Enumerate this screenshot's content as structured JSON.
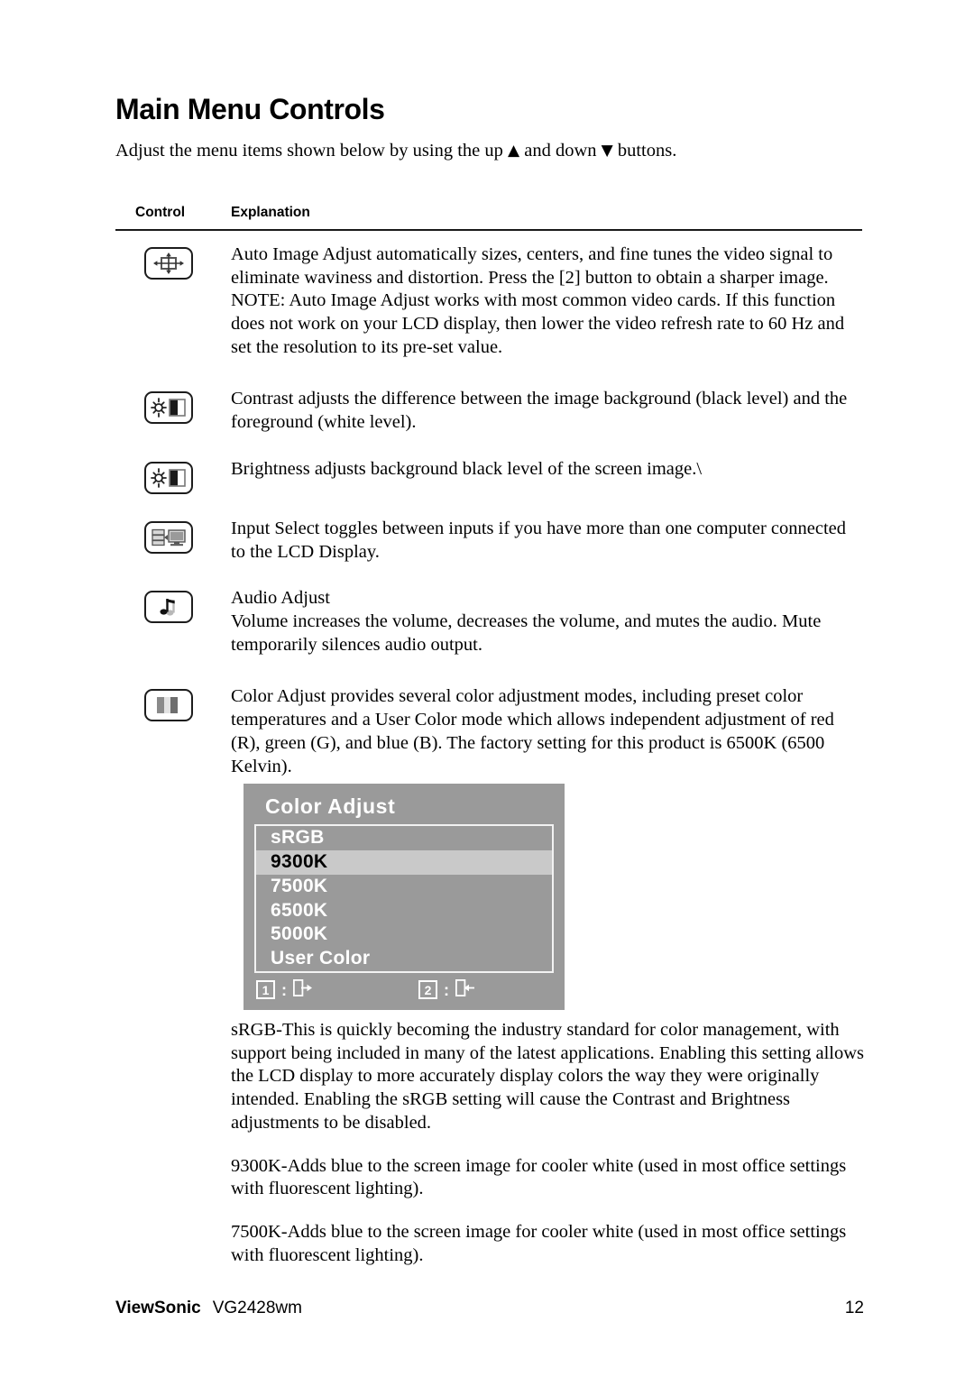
{
  "document": {
    "title": "Main Menu Controls",
    "intro_before": "Adjust the menu items shown below by using the up ",
    "intro_up_glyph": "▲",
    "intro_middle": " and down ",
    "intro_down_glyph": "▼",
    "intro_after": " buttons."
  },
  "table": {
    "header": {
      "control": "Control",
      "explanation": "Explanation"
    },
    "rows": [
      {
        "icon": "auto-image-adjust-icon",
        "paragraphs": [
          "Auto Image Adjust automatically sizes, centers, and fine tunes the video signal to eliminate waviness and distortion. Press the [2] button to obtain a sharper image.",
          "NOTE: Auto Image Adjust works with most common video cards. If this function does not work on your LCD display, then lower the video refresh rate to 60 Hz and set the resolution to its pre-set value."
        ]
      },
      {
        "icon": "contrast-icon",
        "paragraphs": [
          "Contrast adjusts the difference between the image background  (black level) and the foreground (white level)."
        ]
      },
      {
        "icon": "brightness-icon",
        "paragraphs": [
          "Brightness adjusts background black level of the screen image.\\"
        ]
      },
      {
        "icon": "input-select-icon",
        "paragraphs": [
          "Input Select toggles between inputs if you have more than one computer connected to the LCD Display."
        ]
      },
      {
        "icon": "audio-adjust-icon",
        "paragraphs": [
          "Audio Adjust",
          "Volume increases the volume, decreases the volume, and mutes the audio. Mute temporarily silences audio output."
        ]
      },
      {
        "icon": "color-adjust-icon",
        "paragraphs": [
          "Color Adjust provides several color adjustment modes, including preset color temperatures and a User Color mode which allows independent adjustment of red (R), green (G), and blue (B). The factory setting for this product is 6500K (6500 Kelvin)."
        ]
      }
    ]
  },
  "osd": {
    "title": "Color Adjust",
    "background_color": "#9a9a9a",
    "highlight_color": "#c9c9c9",
    "text_color": "#ffffff",
    "selected_text_color": "#000000",
    "items": [
      {
        "label": "sRGB",
        "selected": false
      },
      {
        "label": "9300K",
        "selected": true
      },
      {
        "label": "7500K",
        "selected": false
      },
      {
        "label": "6500K",
        "selected": false
      },
      {
        "label": "5000K",
        "selected": false
      },
      {
        "label": "User Color",
        "selected": false
      }
    ],
    "footer": [
      {
        "key": "1",
        "separator": ":",
        "icon": "exit-right-icon"
      },
      {
        "key": "2",
        "separator": ":",
        "icon": "enter-left-icon"
      }
    ]
  },
  "trailing_paragraphs": [
    "sRGB-This is quickly becoming the industry standard for color management, with support being included in many of the latest applications. Enabling this setting allows the LCD display to more accurately display colors the way they were originally intended. Enabling the sRGB setting will cause the Contrast and Brightness adjustments to be disabled.",
    "9300K-Adds blue to the screen image for cooler white (used in most office settings with fluorescent lighting).",
    "7500K-Adds blue to the screen image for cooler white (used in most office settings with fluorescent lighting)."
  ],
  "footer": {
    "brand": "ViewSonic",
    "model": "VG2428wm",
    "page_number": "12"
  }
}
